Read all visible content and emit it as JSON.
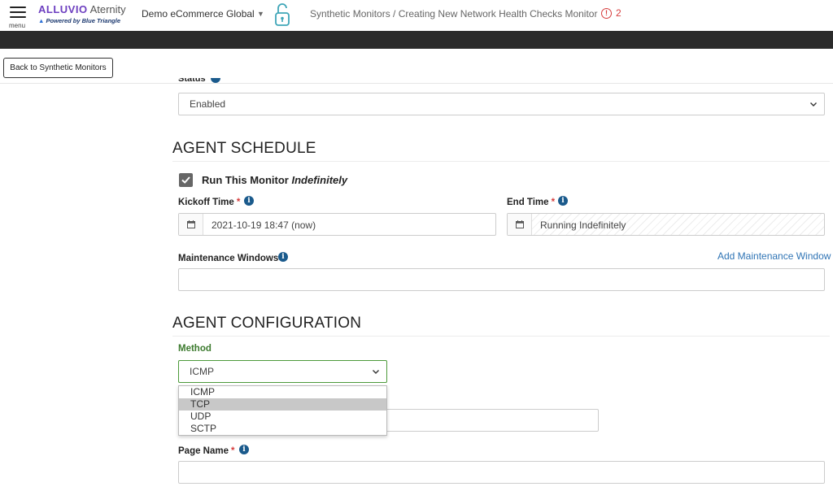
{
  "header": {
    "menu_label": "menu",
    "brand_name": "ALLUVIO",
    "brand_product": "Aternity",
    "brand_tagline": "Powered by Blue Triangle",
    "environment": "Demo eCommerce Global",
    "breadcrumb": "Synthetic Monitors / Creating New Network Health Checks Monitor",
    "alert_count": "2"
  },
  "back_button": "Back to Synthetic Monitors",
  "status": {
    "label": "Status",
    "value": "Enabled"
  },
  "agent_schedule": {
    "title": "AGENT SCHEDULE",
    "run_label": "Run This Monitor",
    "run_label_emphasis": "Indefinitely",
    "run_checked": true,
    "kickoff_label": "Kickoff Time",
    "kickoff_value": "2021-10-19 18:47 (now)",
    "end_label": "End Time",
    "end_value": "Running Indefinitely",
    "maintenance_label": "Maintenance Windows",
    "add_maintenance": "Add Maintenance Window",
    "required_mark": "*"
  },
  "agent_config": {
    "title": "AGENT CONFIGURATION",
    "method_label": "Method",
    "method_value": "ICMP",
    "method_options": [
      "ICMP",
      "TCP",
      "UDP",
      "SCTP"
    ],
    "highlighted_option": "TCP",
    "page_name_label": "Page Name",
    "required_mark": "*"
  },
  "icons": {
    "menu": "hamburger-icon",
    "lock": "unlock-icon",
    "alert": "alert-circle-icon",
    "calendar": "calendar-icon",
    "info": "info-icon",
    "chevron": "chevron-down-icon",
    "check": "checkmark-icon"
  },
  "colors": {
    "brand_purple": "#6d3fc0",
    "alert_red": "#d63d3d",
    "info_blue": "#1a5a8c",
    "link_blue": "#2f74b5",
    "focus_green": "#4c9a3a",
    "dark_bar": "#2b2b2b"
  }
}
